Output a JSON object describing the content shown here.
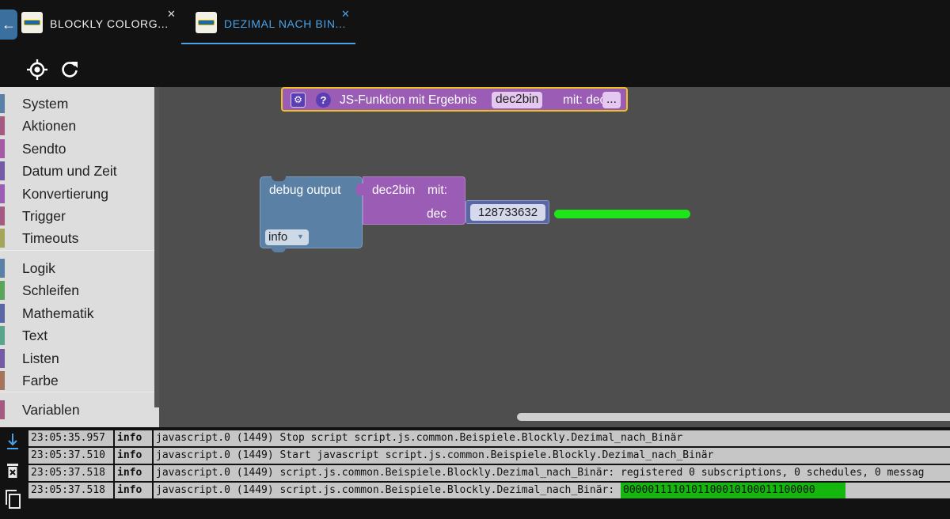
{
  "tabs": [
    {
      "label": "BLOCKLY COLORG...",
      "active": false
    },
    {
      "label": "DEZIMAL NACH BIN...",
      "active": true
    }
  ],
  "toolbox": {
    "categories_group1": [
      {
        "label": "System",
        "color": "#5b80a5"
      },
      {
        "label": "Aktionen",
        "color": "#a55b80"
      },
      {
        "label": "Sendto",
        "color": "#a55ba5"
      },
      {
        "label": "Datum und Zeit",
        "color": "#745ba5"
      },
      {
        "label": "Konvertierung",
        "color": "#9a5cb4"
      },
      {
        "label": "Trigger",
        "color": "#a55b80"
      },
      {
        "label": "Timeouts",
        "color": "#a5a55b"
      }
    ],
    "categories_group2": [
      {
        "label": "Logik",
        "color": "#5b80a5"
      },
      {
        "label": "Schleifen",
        "color": "#5ba55b"
      },
      {
        "label": "Mathematik",
        "color": "#5b67a5"
      },
      {
        "label": "Text",
        "color": "#5ba58c"
      },
      {
        "label": "Listen",
        "color": "#745ba5"
      },
      {
        "label": "Farbe",
        "color": "#a5745b"
      }
    ],
    "categories_group3": [
      {
        "label": "Variablen",
        "color": "#a55b80"
      }
    ]
  },
  "workspace": {
    "function_block": {
      "gear": "⚙",
      "help": "?",
      "text": "JS-Funktion mit Ergebnis",
      "name": "dec2bin",
      "params_label": "mit: dec",
      "more": "..."
    },
    "debug_block": {
      "label": "debug output",
      "level": "info",
      "level_arrow": "▼"
    },
    "call_block": {
      "name": "dec2bin",
      "mit": "mit:",
      "param": "dec"
    },
    "number_block": {
      "value": "128733632"
    }
  },
  "log": [
    {
      "time": "23:05:35.957",
      "severity": "info",
      "message": "javascript.0 (1449) Stop script script.js.common.Beispiele.Blockly.Dezimal_nach_Binär",
      "highlight": ""
    },
    {
      "time": "23:05:37.510",
      "severity": "info",
      "message": "javascript.0 (1449) Start javascript script.js.common.Beispiele.Blockly.Dezimal_nach_Binär",
      "highlight": ""
    },
    {
      "time": "23:05:37.518",
      "severity": "info",
      "message": "javascript.0 (1449) script.js.common.Beispiele.Blockly.Dezimal_nach_Binär: registered 0 subscriptions, 0 schedules, 0 messag",
      "highlight": ""
    },
    {
      "time": "23:05:37.518",
      "severity": "info",
      "message": "javascript.0 (1449) script.js.common.Beispiele.Blockly.Dezimal_nach_Binär:",
      "highlight": "0000011110101100010100011100000"
    }
  ],
  "icons": {
    "back": "←",
    "close": "✕",
    "log_scroll": "⭳",
    "log_clear": "🗑",
    "log_copy": "⧉"
  }
}
